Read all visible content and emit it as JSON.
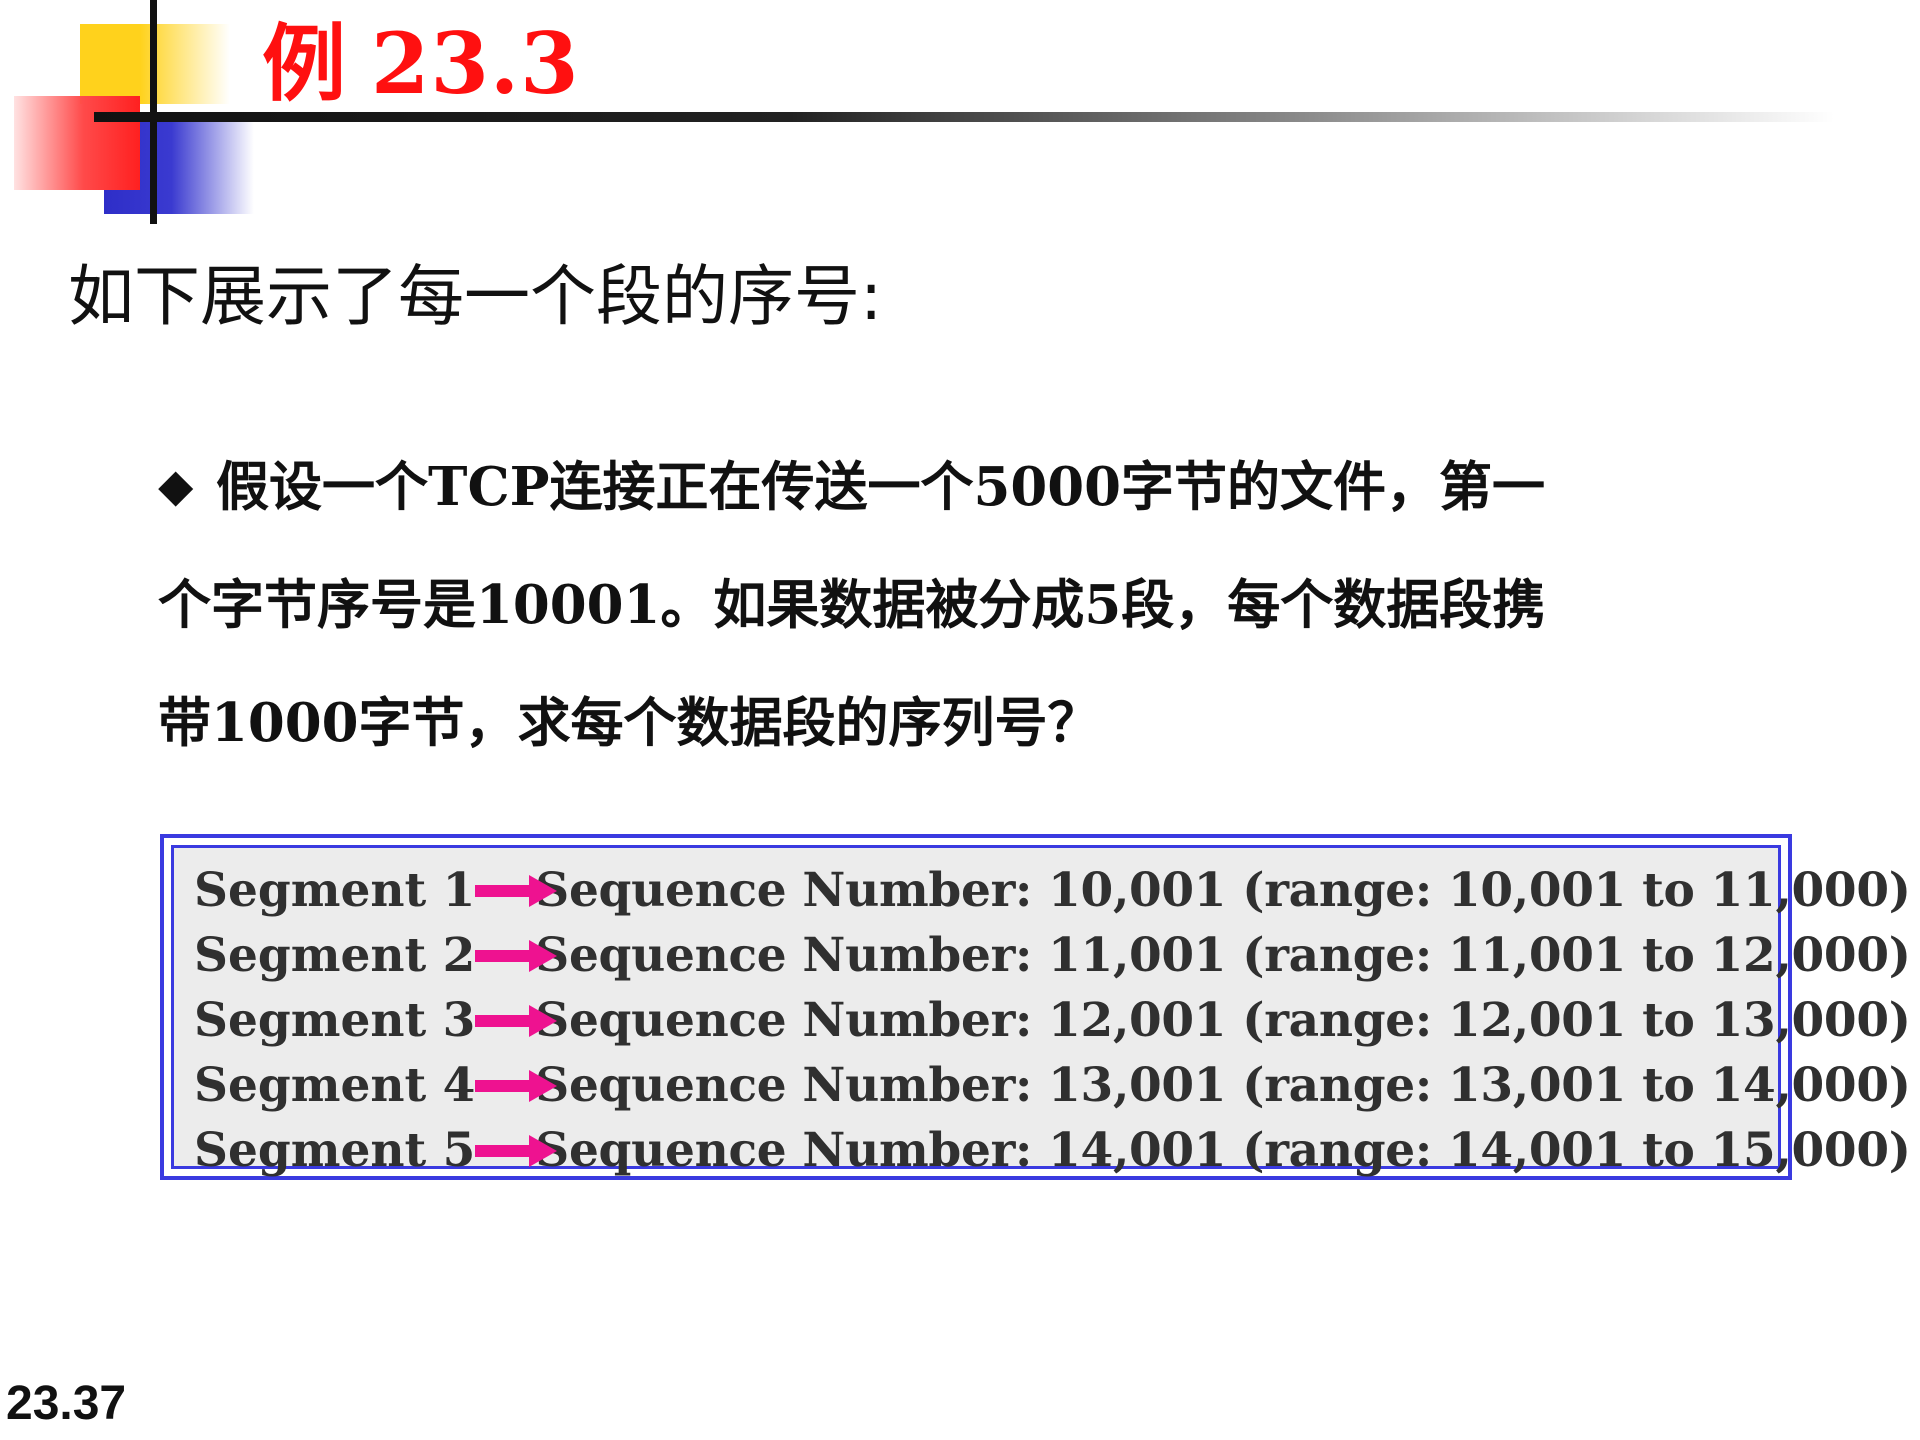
{
  "slide": {
    "title_prefix": "例",
    "title_number": "23.3",
    "subtitle": "如下展示了每一个段的序号:",
    "bullet": {
      "icon": "diamond-bullet-icon",
      "lines": [
        "假设一个TCP连接正在传送一个5000字节的文件，第一",
        "个字节序号是10001。如果数据被分成5段，每个数据段携",
        "带1000字节，求每个数据段的序列号？"
      ]
    },
    "segments": [
      {
        "label": "Segment 1",
        "text": "Sequence Number: 10,001 (range: 10,001 to 11,000)"
      },
      {
        "label": "Segment 2",
        "text": "Sequence Number: 11,001 (range: 11,001 to 12,000)"
      },
      {
        "label": "Segment 3",
        "text": "Sequence Number: 12,001 (range: 12,001 to 13,000)"
      },
      {
        "label": "Segment 4",
        "text": "Sequence Number: 13,001 (range: 13,001 to 14,000)"
      },
      {
        "label": "Segment 5",
        "text": "Sequence Number: 14,001 (range: 14,001 to 15,000)"
      }
    ],
    "page_number": "23.37"
  },
  "colors": {
    "title": "#ff1010",
    "arrow": "#ee1290",
    "box_border": "#3a3ae0",
    "box_fill": "#ececec",
    "logo_yellow": "#ffd21c",
    "logo_red": "#ff2020",
    "logo_blue": "#2e2ec8"
  }
}
